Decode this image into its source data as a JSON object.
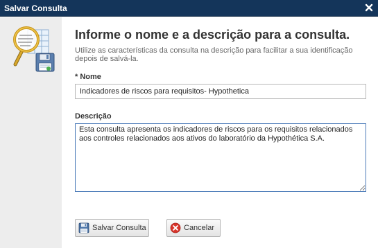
{
  "dialog": {
    "title": "Salvar Consulta",
    "close_icon": "close-icon"
  },
  "left_panel": {
    "logo_icon": "search-save-icon"
  },
  "form": {
    "heading": "Informe o nome e a descrição para a consulta.",
    "subtext": "Utilize as características da consulta na descrição para facilitar a sua identificação depois de salvá-la.",
    "name": {
      "required_mark": "* ",
      "label": "Nome",
      "value": "Indicadores de riscos para requisitos- Hypothetica"
    },
    "description": {
      "label": "Descrição",
      "value": "Esta consulta apresenta os indicadores de riscos para os requisitos relacionados aos controles relacionados aos ativos do laboratório da Hypothética S.A."
    }
  },
  "buttons": {
    "save_label": "Salvar Consulta",
    "save_icon": "floppy-disk-icon",
    "cancel_label": "Cancelar",
    "cancel_icon": "cancel-circle-icon"
  },
  "colors": {
    "titlebar": "#14355a",
    "left_panel": "#ededed",
    "focus_border": "#4a7ab8",
    "cancel_icon": "#d9342b"
  }
}
